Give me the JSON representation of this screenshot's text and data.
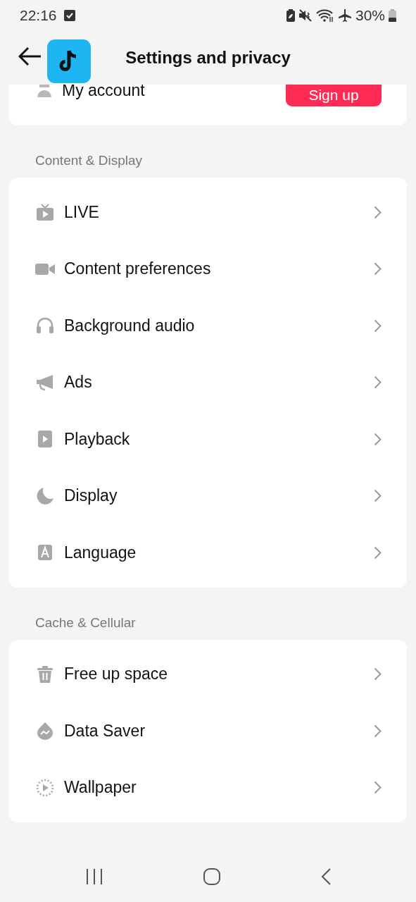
{
  "status_bar": {
    "time": "22:16",
    "battery": "30%"
  },
  "header": {
    "title": "Settings and privacy"
  },
  "account": {
    "label": "My account",
    "button": "Sign up"
  },
  "sections": [
    {
      "title": "Content & Display",
      "items": [
        {
          "label": "LIVE"
        },
        {
          "label": "Content preferences"
        },
        {
          "label": "Background audio"
        },
        {
          "label": "Ads"
        },
        {
          "label": "Playback"
        },
        {
          "label": "Display"
        },
        {
          "label": "Language"
        }
      ]
    },
    {
      "title": "Cache & Cellular",
      "items": [
        {
          "label": "Free up space"
        },
        {
          "label": "Data Saver"
        },
        {
          "label": "Wallpaper"
        }
      ]
    }
  ]
}
